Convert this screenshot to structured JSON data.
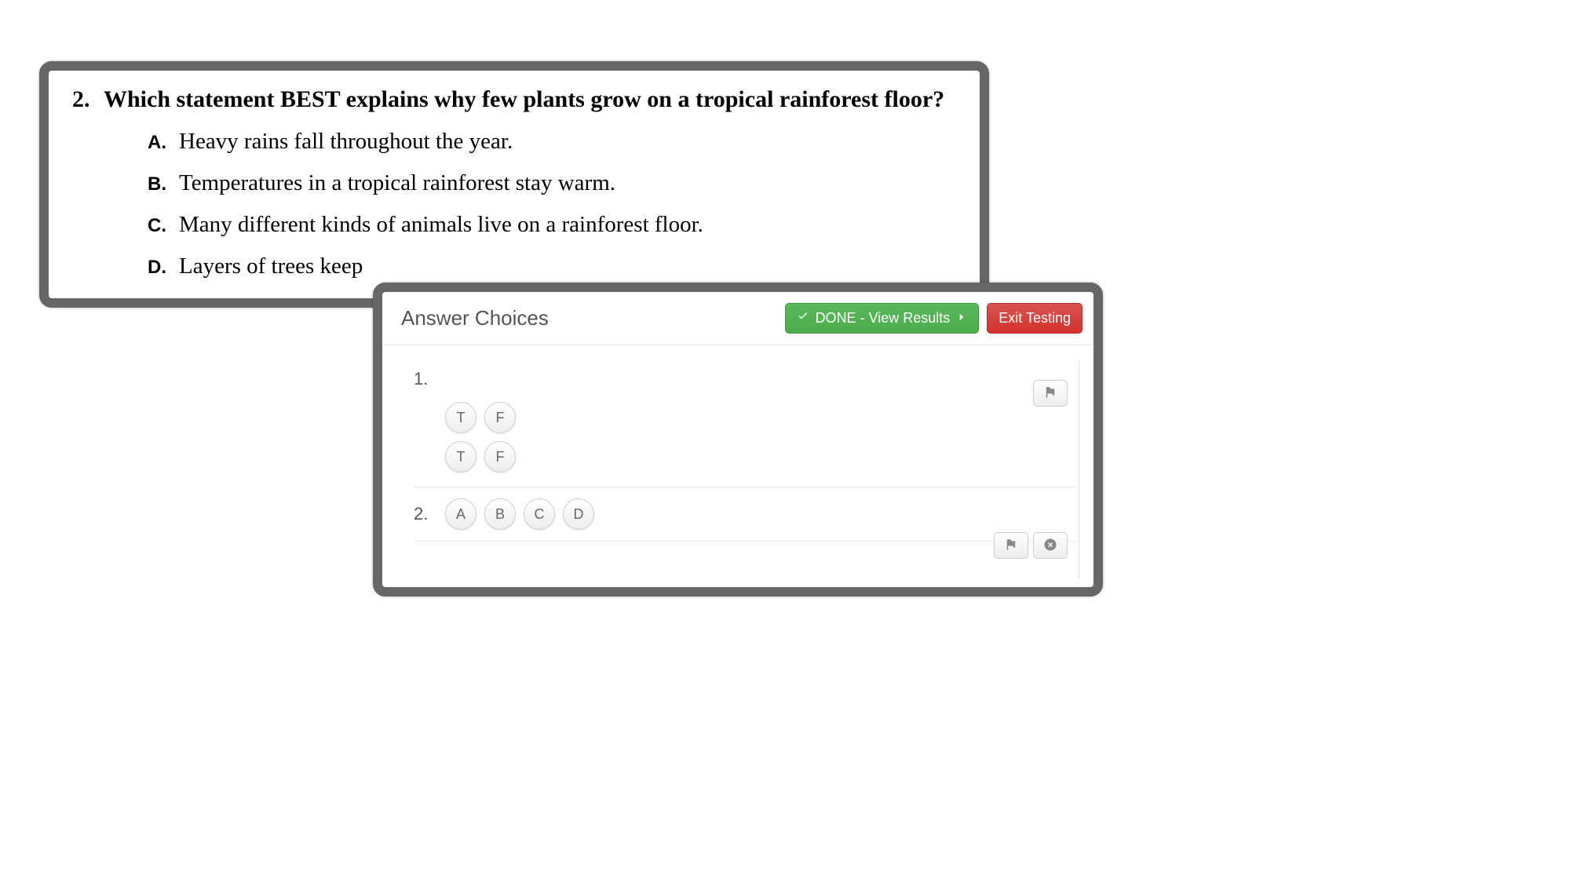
{
  "question": {
    "number": "2.",
    "prompt": "Which statement BEST explains why few plants grow on a tropical rainforest floor?",
    "options": {
      "a_letter": "A.",
      "a_text": "Heavy rains fall throughout the year.",
      "b_letter": "B.",
      "b_text": "Temperatures in a tropical rainforest stay warm.",
      "c_letter": "C.",
      "c_text": "Many different kinds of animals live on a rainforest floor.",
      "d_letter": "D.",
      "d_text": "Layers of trees keep"
    }
  },
  "panel": {
    "title": "Answer Choices",
    "done_label": "DONE - View Results",
    "exit_label": "Exit Testing",
    "rows": {
      "r1_num": "1.",
      "r2_num": "2."
    },
    "tf": {
      "t": "T",
      "f": "F"
    },
    "abcd": {
      "a": "A",
      "b": "B",
      "c": "C",
      "d": "D"
    }
  }
}
